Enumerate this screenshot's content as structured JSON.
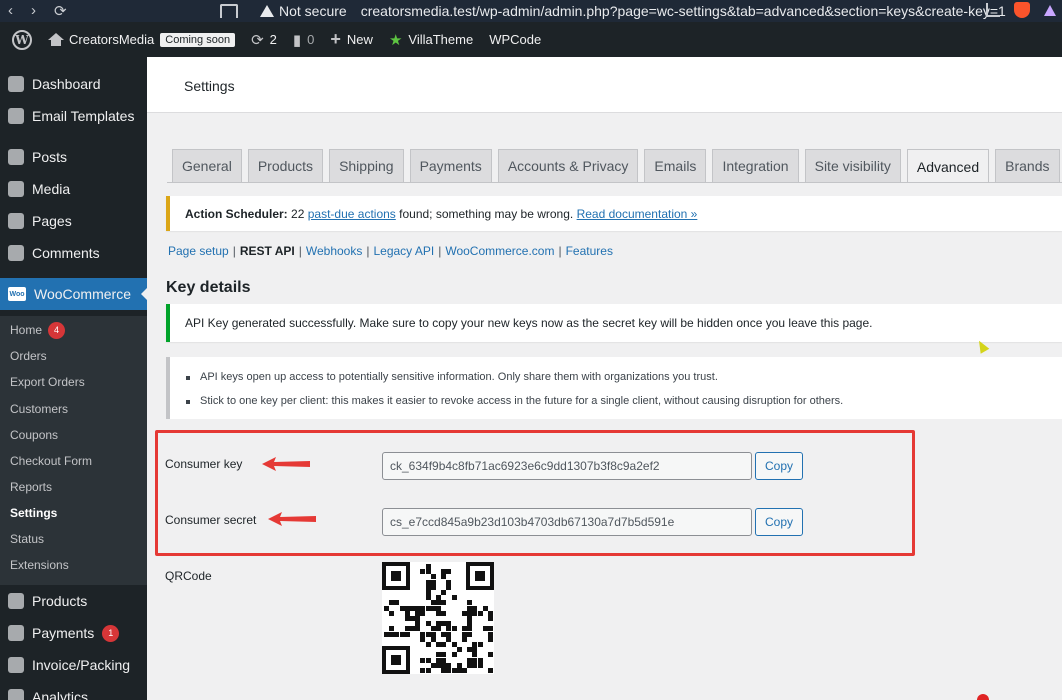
{
  "browser": {
    "warning": "Not secure",
    "url": "creatorsmedia.test/wp-admin/admin.php?page=wc-settings&tab=advanced&section=keys&create-key=1"
  },
  "adminbar": {
    "site_name": "CreatorsMedia",
    "coming_soon": "Coming soon",
    "updates_count": "2",
    "comments_count": "0",
    "new_label": "New",
    "villatheme_label": "VillaTheme",
    "wpcode_label": "WPCode"
  },
  "sidebar": {
    "items": [
      {
        "label": "Dashboard"
      },
      {
        "label": "Email Templates"
      },
      {
        "label": "Posts"
      },
      {
        "label": "Media"
      },
      {
        "label": "Pages"
      },
      {
        "label": "Comments"
      }
    ],
    "woocommerce": "WooCommerce",
    "submenu": [
      {
        "label": "Home",
        "badge": "4"
      },
      {
        "label": "Orders"
      },
      {
        "label": "Export Orders"
      },
      {
        "label": "Customers"
      },
      {
        "label": "Coupons"
      },
      {
        "label": "Checkout Form"
      },
      {
        "label": "Reports"
      },
      {
        "label": "Settings"
      },
      {
        "label": "Status"
      },
      {
        "label": "Extensions"
      }
    ],
    "bottom": [
      {
        "label": "Products"
      },
      {
        "label": "Payments",
        "badge": "1"
      },
      {
        "label": "Invoice/Packing"
      },
      {
        "label": "Analytics"
      }
    ]
  },
  "page": {
    "title": "Settings"
  },
  "tabs": [
    "General",
    "Products",
    "Shipping",
    "Payments",
    "Accounts & Privacy",
    "Emails",
    "Integration",
    "Site visibility",
    "Advanced",
    "Brands"
  ],
  "action_notice": {
    "prefix": "Action Scheduler:",
    "count_text": "22",
    "link1": "past-due actions",
    "middle": "found; something may be wrong.",
    "link2": "Read documentation »"
  },
  "subsections": {
    "page_setup": "Page setup",
    "rest_api": "REST API",
    "webhooks": "Webhooks",
    "legacy_api": "Legacy API",
    "woocommerce_com": "WooCommerce.com",
    "features": "Features"
  },
  "key_details": {
    "heading": "Key details",
    "success": "API Key generated successfully. Make sure to copy your new keys now as the secret key will be hidden once you leave this page.",
    "info": [
      "API keys open up access to potentially sensitive information. Only share them with organizations you trust.",
      "Stick to one key per client: this makes it easier to revoke access in the future for a single client, without causing disruption for others."
    ],
    "consumer_key_label": "Consumer key",
    "consumer_key_value": "ck_634f9b4c8fb71ac6923e6c9dd1307b3f8c9a2ef2",
    "consumer_secret_label": "Consumer secret",
    "consumer_secret_value": "cs_e7ccd845a9b23d103b4703db67130a7d7b5d591e",
    "copy_label": "Copy",
    "qrcode_label": "QRCode"
  },
  "colors": {
    "accent": "#2271b1",
    "highlight": "#e53935",
    "success": "#00a32a",
    "warning": "#dba617"
  }
}
